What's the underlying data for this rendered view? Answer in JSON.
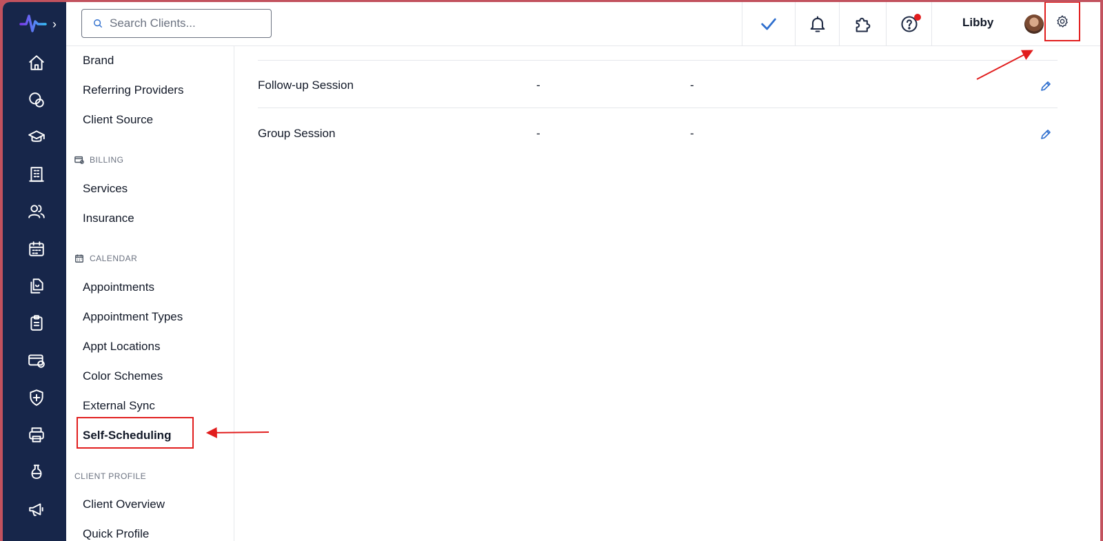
{
  "search": {
    "placeholder": "Search Clients..."
  },
  "header": {
    "user_name": "Libby"
  },
  "settings_nav": {
    "top_items": [
      "Brand",
      "Referring Providers",
      "Client Source"
    ],
    "billing": {
      "label": "BILLING",
      "items": [
        "Services",
        "Insurance"
      ]
    },
    "calendar": {
      "label": "CALENDAR",
      "items": [
        "Appointments",
        "Appointment Types",
        "Appt Locations",
        "Color Schemes",
        "External Sync",
        "Self-Scheduling"
      ]
    },
    "client_profile": {
      "label": "CLIENT PROFILE",
      "items": [
        "Client Overview",
        "Quick Profile"
      ]
    },
    "active_item": "Self-Scheduling"
  },
  "table": {
    "rows": [
      {
        "name": "Follow-up Session",
        "col2": "-",
        "col3": "-"
      },
      {
        "name": "Group Session",
        "col2": "-",
        "col3": "-"
      }
    ]
  },
  "colors": {
    "rail": "#17264a",
    "accent_blue": "#2f6fce",
    "annotation_red": "#e11d1d",
    "notification_dot": "#e11d1d"
  },
  "icons": {
    "rail": [
      "home-icon",
      "messages-icon",
      "education-icon",
      "building-icon",
      "users-icon",
      "calendar-icon",
      "documents-icon",
      "clipboard-icon",
      "billing-icon",
      "shield-icon",
      "printer-icon",
      "lab-flask-icon",
      "megaphone-icon"
    ],
    "header": [
      "checkmark-icon",
      "bell-icon",
      "puzzle-icon",
      "help-icon",
      "gear-icon"
    ]
  }
}
